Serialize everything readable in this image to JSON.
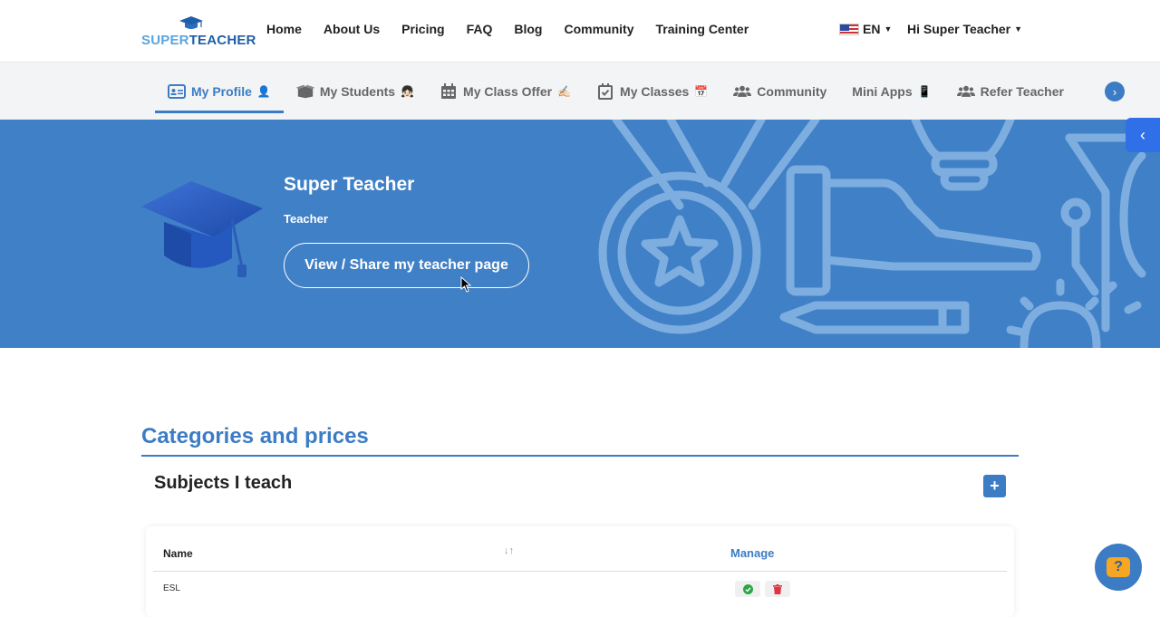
{
  "brand": {
    "logo_part1": "SUPER",
    "logo_part2": "TEACHER",
    "colors": {
      "primary": "#3c7cc4",
      "hero": "#4080c6",
      "accent": "#f5a623"
    }
  },
  "topnav": {
    "links": [
      "Home",
      "About Us",
      "Pricing",
      "FAQ",
      "Blog",
      "Community",
      "Training Center"
    ],
    "language": "EN",
    "greeting": "Hi Super Teacher"
  },
  "tabs": [
    {
      "label": "My Profile",
      "icon": "id-card-icon",
      "emoji": "👤"
    },
    {
      "label": "My Students",
      "icon": "box-icon",
      "emoji": "👧🏻"
    },
    {
      "label": "My Class Offer",
      "icon": "calendar-grid-icon",
      "emoji": "✍🏻"
    },
    {
      "label": "My Classes",
      "icon": "calendar-check-icon",
      "emoji": "📅"
    },
    {
      "label": "Community",
      "icon": "users-icon",
      "emoji": ""
    },
    {
      "label": "Mini Apps",
      "icon": "",
      "emoji": "📱"
    },
    {
      "label": "Refer Teacher",
      "icon": "users-icon",
      "emoji": ""
    }
  ],
  "hero": {
    "name": "Super Teacher",
    "role": "Teacher",
    "share_button": "View / Share my teacher page"
  },
  "categories": {
    "title": "Categories and prices",
    "subjects_title": "Subjects I teach",
    "add_label": "+",
    "table": {
      "col_name": "Name",
      "col_manage": "Manage",
      "rows": [
        {
          "name": "ESL"
        }
      ]
    }
  },
  "help_label": "?"
}
